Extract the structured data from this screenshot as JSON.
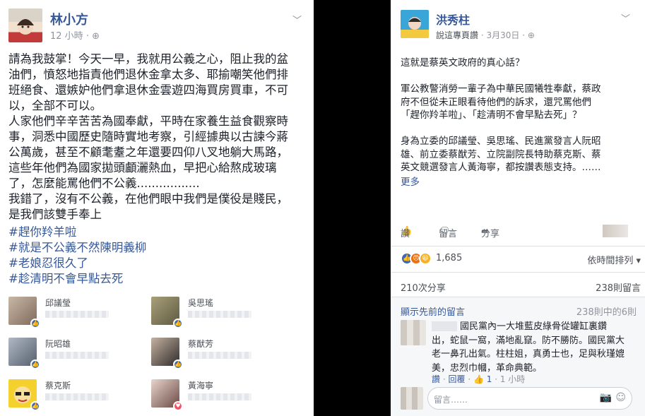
{
  "left_post": {
    "author": "林小方",
    "time": "12 小時",
    "privacy_icon": "globe-icon",
    "body": "請為我鼓掌！今天一早，我就用公義之心，阻止我的盆\n油們，憤怒地指責他們退休金拿太多、耶揄嘲笑他們排\n班絕食、還嫉妒他們拿退休金雲遊四海買房買車，不可\n以，全部不可以。\n人家他們辛辛苦苦為國奉獻，平時在家養生益食觀察時\n事，洞悉中國歷史隨時實地考察，引經據典以古諫今蔣\n公萬歲，甚至不顧耄耋之年還要四仰八叉地躺大馬路，\n這些年他們為國家拋頭顱灑熱血，早把心給熬成玻璃\n了，怎麼能罵他們不公義.................\n我錯了，沒有不公義，在他們眼中我們是僕役是賤民，\n是我們該雙手奉上",
    "hashtags": [
      "#趕你羚羊啦",
      "#就是不公義不然陳明義柳",
      "#老娘忍很久了",
      "#趁清明不會早點去死"
    ],
    "tagged": [
      {
        "name": "邱議瑩",
        "reaction": "like"
      },
      {
        "name": "吳思瑤",
        "reaction": "like"
      },
      {
        "name": "阮昭雄",
        "reaction": "like"
      },
      {
        "name": "蔡猷芳",
        "reaction": "like"
      },
      {
        "name": "蔡克斯",
        "reaction": "like"
      },
      {
        "name": "黃海寧",
        "reaction": "love"
      }
    ]
  },
  "right_post": {
    "author": "洪秀柱",
    "page_label": "說這專頁讚",
    "date": "3月30日",
    "privacy_icon": "globe-icon",
    "body": "這就是蔡英文政府的真心話？\n\n軍公教警消勞一輩子為中華民國犧牲奉獻，蔡政\n府不但從未正眼看待他們的訴求，還咒罵他們\n「趕你羚羊啦」、「趁清明不會早點去死」？\n\n身為立委的邱議瑩、吳思瑤、民進黨發言人阮昭\n雄、前立委蔡猷芳、立院副院長特助蔡克斯、蔡\n英文競選發言人黃海寧，都按讚表態支持。……",
    "more": "更多",
    "actions": {
      "like": "讚",
      "comment": "留言",
      "share": "分享"
    },
    "reaction_count": "1,685",
    "sort_label": "依時間排列",
    "shares": "210次分享",
    "comments_count": "238則留言",
    "prev_comments": "顯示先前的留言",
    "prev_counter": "238則中的6則",
    "comment": {
      "text": "國民黨內一大堆藍皮綠骨從罐缸裏鑽\n出，蛇鼠一窩，滿地亂竄。防不勝防。國民黨大\n老一鼻孔出氣。柱柱姐，真勇士也，足與秋瑾媲\n美，忠烈巾幗，革命典範。",
      "like": "讚",
      "reply": "回覆",
      "likes": "1",
      "time": "1 小時"
    },
    "reply_placeholder": "留言……"
  },
  "colors": {
    "link": "#365899",
    "like_blue": "#4267b2",
    "love_red": "#f25268",
    "haha_yellow": "#f7b125"
  }
}
